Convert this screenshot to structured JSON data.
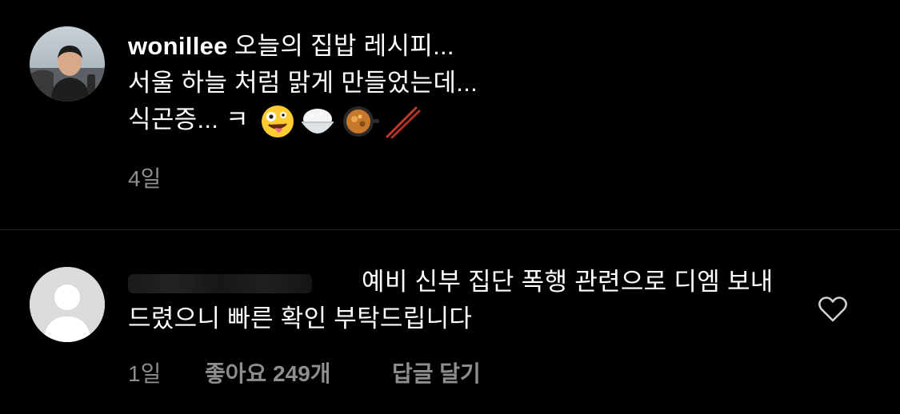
{
  "caption": {
    "username": "wonillee",
    "line1": "오늘의 집밥 레시피...",
    "line2": "서울 하늘 처럼 맑게 만들었는데...",
    "line3": "식곤증... ㅋ",
    "emojis": [
      "zany-face-emoji",
      "cooked-rice-emoji",
      "shallow-pan-food-emoji",
      "chopsticks-emoji"
    ],
    "time": "4일"
  },
  "comment": {
    "text": "예비 신부 집단 폭행 관련으로 디엠 보내드렸으니 빠른 확인 부탁드립니다",
    "time": "1일",
    "likes": "좋아요 249개",
    "reply_label": "답글 달기",
    "like_icon": "heart-outline-icon"
  },
  "colors": {
    "background": "#000000",
    "text": "#ffffff",
    "secondary_text": "#8e8e8e",
    "divider": "#262626",
    "default_avatar": "#dbdbdb"
  }
}
